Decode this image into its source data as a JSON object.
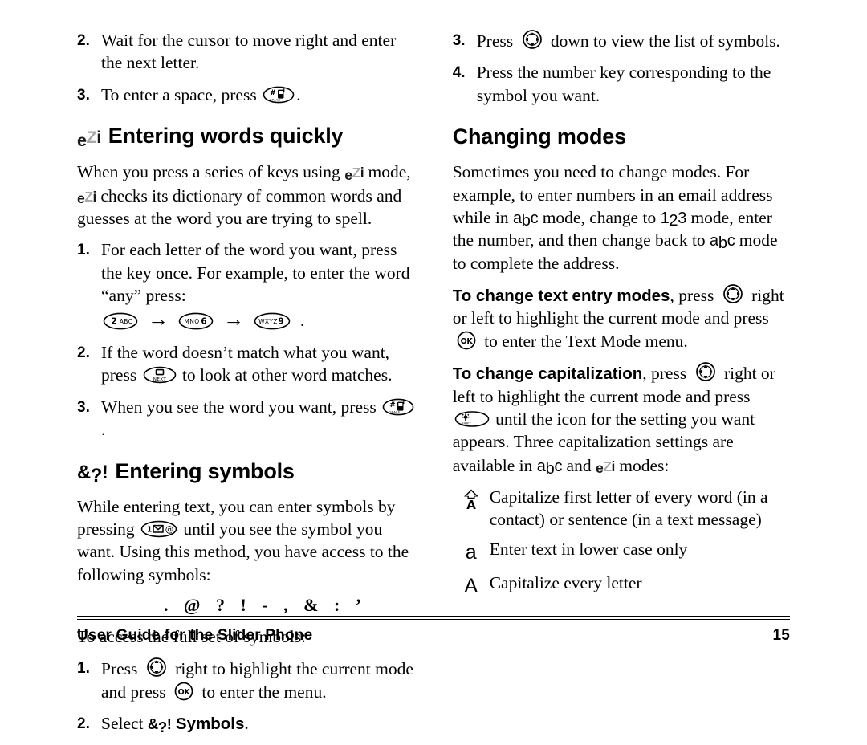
{
  "document": {
    "title": "User Guide for the Slider Phone",
    "page_number": "15"
  },
  "left_column": {
    "top_steps": [
      {
        "num": "2.",
        "text_before": "Wait for the cursor to move right and enter the next letter.",
        "key": null,
        "text_after": ""
      },
      {
        "num": "3.",
        "text_before": "To enter a space, press",
        "key": "space-key",
        "text_after": "."
      }
    ],
    "section_ezi": {
      "glyph": {
        "e": "e",
        "z": "Z",
        "i": "i"
      },
      "heading": "Entering words quickly",
      "intro_part1": "When you press a series of keys using",
      "intro_part2": "mode,",
      "intro_part3": "checks its dictionary of common words and guesses at the word you are trying to spell.",
      "steps": [
        {
          "num": "1.",
          "text": "For each letter of the word you want, press the key once. For example, to enter the word “any” press:",
          "key_sequence": [
            {
              "digit": "2",
              "letters": "ABC"
            },
            {
              "digit": "6",
              "letters": "MNO"
            },
            {
              "digit": "9",
              "letters": "WXYZ"
            }
          ],
          "sequence_arrow": "→",
          "sequence_end": "."
        },
        {
          "num": "2.",
          "text_before": "If the word doesn’t match what you want, press",
          "key": "next-key",
          "text_after": "to look at other word matches."
        },
        {
          "num": "3.",
          "text_before": "When you see the word you want, press",
          "key": "space-key",
          "text_after": "."
        }
      ]
    },
    "section_symbols": {
      "glyph": {
        "amp": "&",
        "q": "?",
        "excl": "!"
      },
      "heading": "Entering symbols",
      "para_before": "While entering text, you can enter symbols by pressing",
      "key": "message-key",
      "para_after": "until you see the symbol you want. Using this method, you have access to the following symbols:",
      "symbol_list": ".  @ ? ! -  ,  & : ’",
      "access_line": "To access the full set of symbols:",
      "steps": [
        {
          "num": "1.",
          "text_before": "Press",
          "key1": "navigation-key",
          "text_middle": "right to highlight the current mode and press",
          "key2": "ok-key",
          "text_after": "to enter the menu."
        },
        {
          "num": "2.",
          "text_before": "Select",
          "glyph_label": "&?!",
          "bold_label": "Symbols",
          "text_after": "."
        }
      ]
    }
  },
  "right_column": {
    "top_steps": [
      {
        "num": "3.",
        "text_before": "Press",
        "key": "navigation-key",
        "text_after": "down to view the list of symbols."
      },
      {
        "num": "4.",
        "text_before": "Press the number key corresponding to the symbol you want.",
        "key": null,
        "text_after": ""
      }
    ],
    "section_modes": {
      "heading": "Changing modes",
      "intro_p1": "Sometimes you need to change modes. For example, to enter numbers in an email address while in",
      "intro_p2": "mode, change to",
      "intro_p3": "mode, enter the number, and then change back to",
      "intro_p4": "mode to complete the address.",
      "mode_abc": {
        "a": "a",
        "b": "b",
        "c": "c"
      },
      "mode_123": {
        "one": "1",
        "two": "2",
        "three": "3"
      },
      "para_text_entry": {
        "bold": "To change text entry modes",
        "part1": ", press",
        "key1": "navigation-key",
        "part2": "right or left to highlight the current mode and press",
        "key2": "ok-key",
        "part3": "to enter the Text Mode menu."
      },
      "para_capitalization": {
        "bold": "To change capitalization",
        "part1": ", press",
        "key1": "navigation-key",
        "part2": "right or left to highlight the current mode and press",
        "key2": "shift-key",
        "part3": "until the icon for the setting you want appears. Three capitalization settings are available in",
        "part4": "and",
        "part5": "modes:"
      },
      "cap_items": [
        {
          "glyph": "shift-a-icon",
          "text": "Capitalize first letter of every word (in a contact) or sentence (in a text message)"
        },
        {
          "glyph": "lowercase-a-icon",
          "text": "Enter text in lower case only"
        },
        {
          "glyph": "uppercase-a-icon",
          "text": "Capitalize every letter"
        }
      ]
    }
  },
  "keys": {
    "space": {
      "hash": "#",
      "label": "SPACE"
    },
    "next": {
      "label": "NEXT"
    },
    "ok": {
      "label": "OK"
    },
    "message": {
      "digit": "1",
      "at": "@"
    },
    "shift": {
      "label": "SHIFT"
    },
    "navigation": {
      "label": "navigation-ring"
    }
  },
  "colors": {
    "text": "#000000",
    "ezi_gray": "#a8a8a8",
    "page_bg": "#ffffff"
  }
}
